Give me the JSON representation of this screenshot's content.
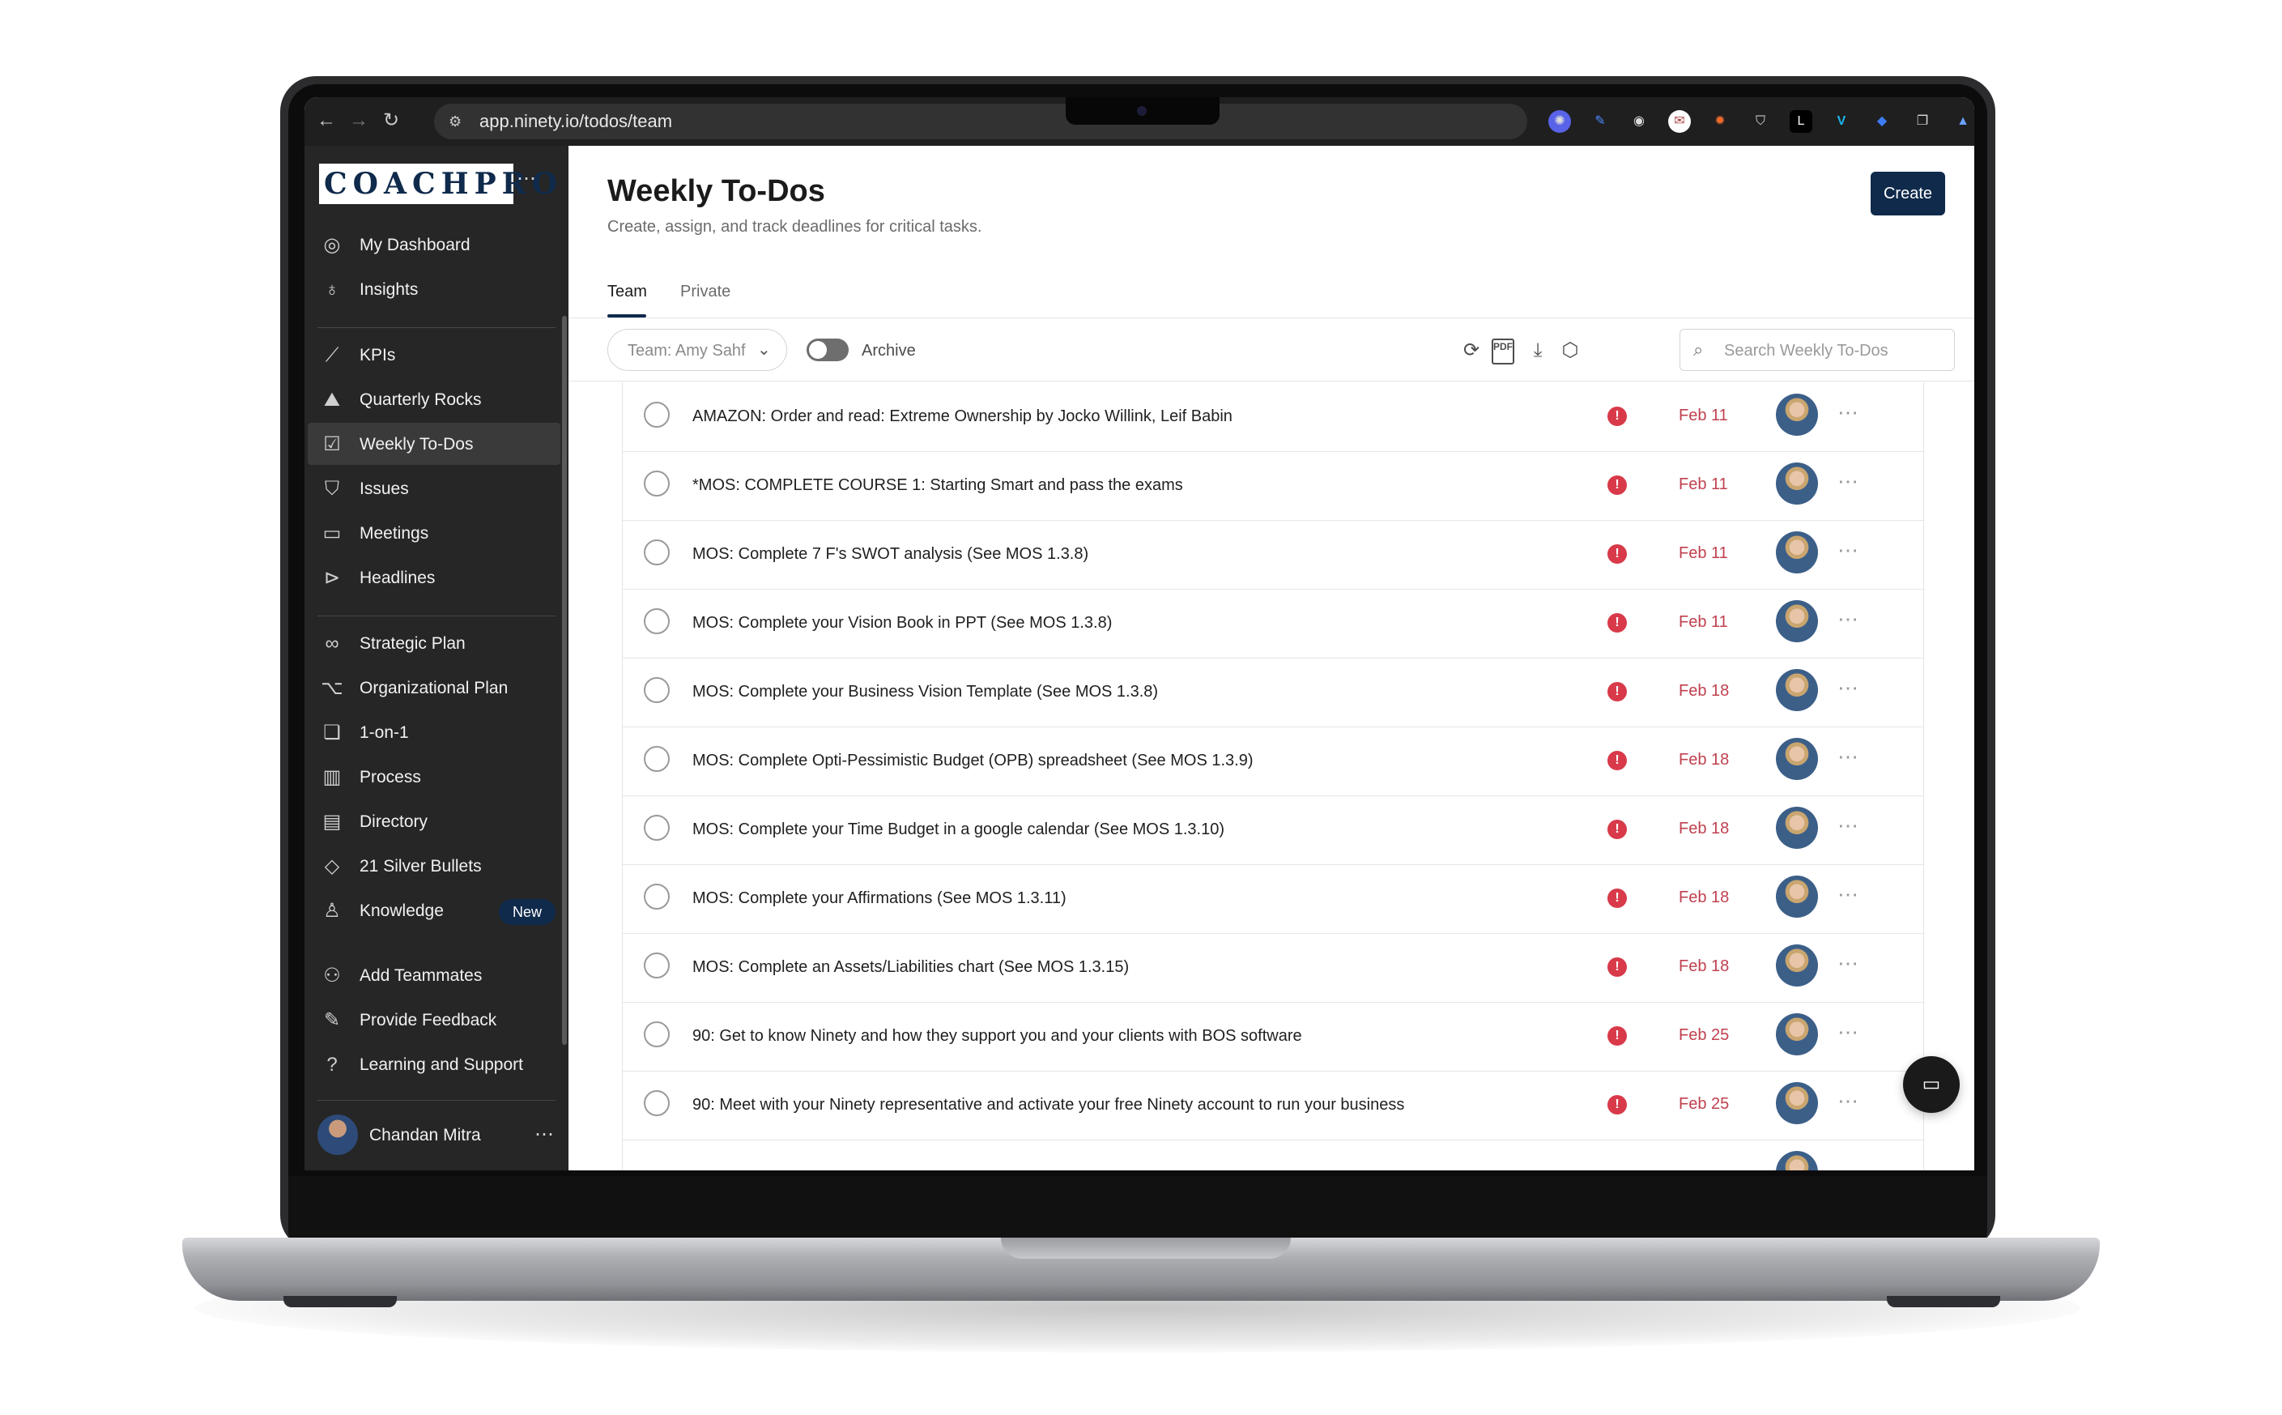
{
  "browser": {
    "url": "app.ninety.io/todos/team"
  },
  "sidebar": {
    "logo_text": "COACHPRO",
    "logo_more": "⋯",
    "items": [
      {
        "label": "My Dashboard",
        "icon": "target-icon"
      },
      {
        "label": "Insights",
        "icon": "lightbulb-icon"
      },
      {
        "label": "KPIs",
        "icon": "chart-line-icon"
      },
      {
        "label": "Quarterly Rocks",
        "icon": "mountain-icon"
      },
      {
        "label": "Weekly To-Dos",
        "icon": "checkbox-icon"
      },
      {
        "label": "Issues",
        "icon": "shield-alert-icon"
      },
      {
        "label": "Meetings",
        "icon": "chat-bubble-icon"
      },
      {
        "label": "Headlines",
        "icon": "megaphone-icon"
      },
      {
        "label": "Strategic Plan",
        "icon": "binoculars-icon"
      },
      {
        "label": "Organizational Plan",
        "icon": "org-chart-icon"
      },
      {
        "label": "1-on-1",
        "icon": "conversation-icon"
      },
      {
        "label": "Process",
        "icon": "books-icon"
      },
      {
        "label": "Directory",
        "icon": "contact-book-icon"
      },
      {
        "label": "21 Silver Bullets",
        "icon": "graduation-cap-icon"
      },
      {
        "label": "Knowledge",
        "icon": "teacher-icon",
        "badge": "New"
      },
      {
        "label": "Add Teammates",
        "icon": "add-user-icon"
      },
      {
        "label": "Provide Feedback",
        "icon": "edit-square-icon"
      },
      {
        "label": "Learning and Support",
        "icon": "help-circle-icon"
      }
    ],
    "user": {
      "name": "Chandan Mitra",
      "more": "⋯"
    }
  },
  "page": {
    "title": "Weekly To-Dos",
    "subtitle": "Create, assign, and track deadlines for critical tasks.",
    "create_label": "Create",
    "tabs": [
      "Team",
      "Private"
    ],
    "team_filter": "Team: Amy Sahf",
    "archive_label": "Archive",
    "archive_on": false,
    "search_placeholder": "Search Weekly To-Dos",
    "pdf_label": "PDF"
  },
  "todos": [
    {
      "title": "AMAZON: Order and read: Extreme Ownership by Jocko Willink, Leif Babin",
      "date": "Feb 11"
    },
    {
      "title": "*MOS: COMPLETE COURSE 1: Starting Smart and pass the exams",
      "date": "Feb 11"
    },
    {
      "title": "MOS: Complete 7 F's SWOT analysis (See MOS 1.3.8)",
      "date": "Feb 11"
    },
    {
      "title": "MOS: Complete your Vision Book in PPT (See MOS 1.3.8)",
      "date": "Feb 11"
    },
    {
      "title": "MOS: Complete your Business Vision Template (See MOS 1.3.8)",
      "date": "Feb 18"
    },
    {
      "title": "MOS: Complete Opti-Pessimistic Budget (OPB) spreadsheet (See MOS 1.3.9)",
      "date": "Feb 18"
    },
    {
      "title": "MOS: Complete your Time Budget in a google calendar (See MOS 1.3.10)",
      "date": "Feb 18"
    },
    {
      "title": "MOS: Complete your Affirmations (See MOS 1.3.11)",
      "date": "Feb 18"
    },
    {
      "title": "MOS: Complete an Assets/Liabilities chart (See MOS 1.3.15)",
      "date": "Feb 18"
    },
    {
      "title": "90: Get to know Ninety and how they support you and your clients with BOS software",
      "date": "Feb 25"
    },
    {
      "title": "90: Meet with your Ninety representative and activate your free Ninety account to run your business",
      "date": "Feb 25"
    }
  ],
  "colors": {
    "brand_navy": "#0f2a4b",
    "sidebar_bg": "#262626",
    "overdue_red": "#d83a4a",
    "date_red": "#c0414f"
  }
}
